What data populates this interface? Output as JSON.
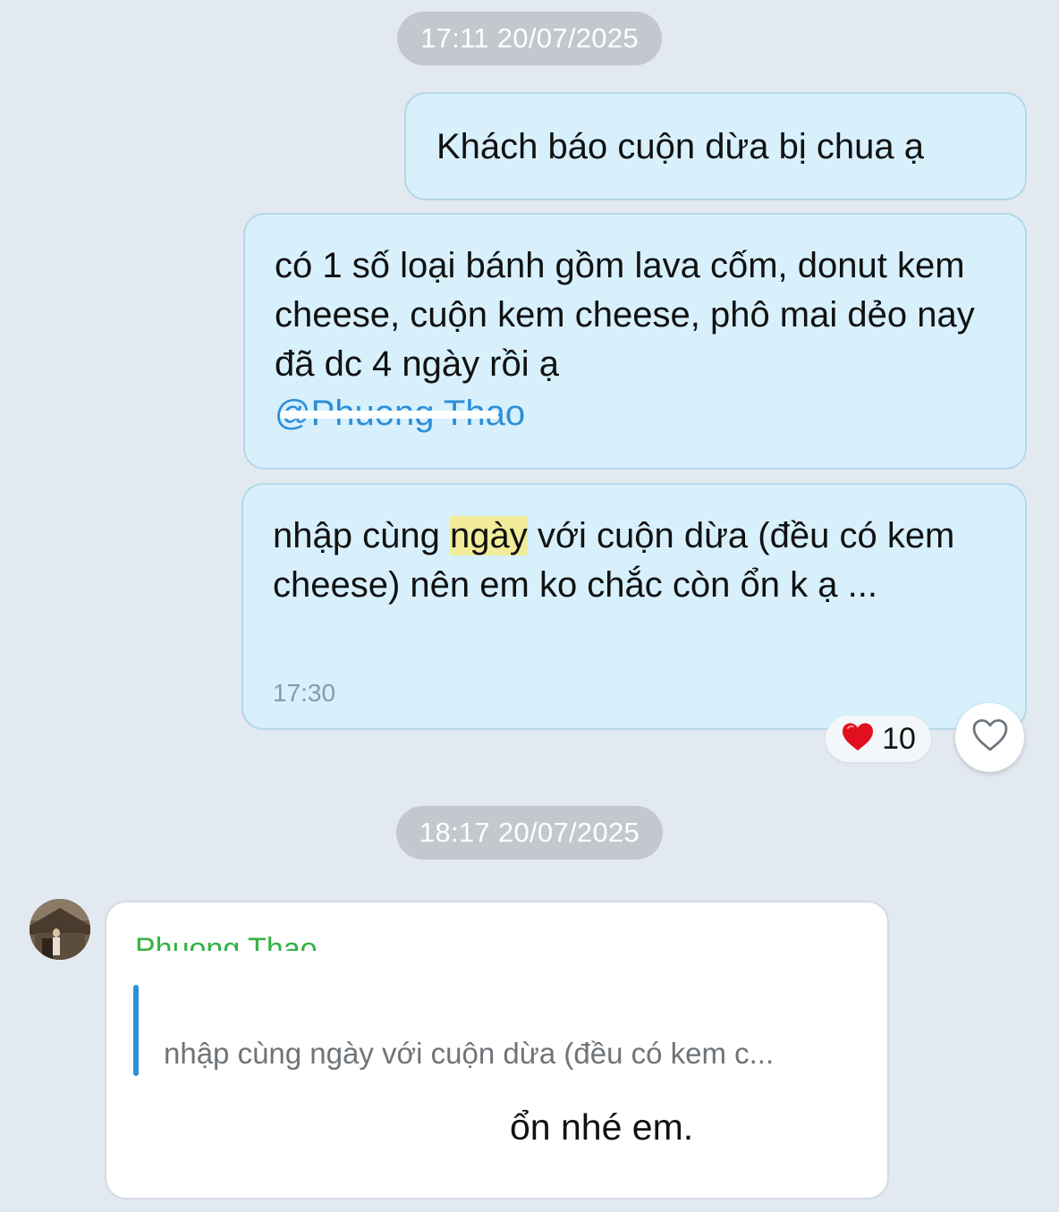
{
  "timestamps": {
    "first": "17:11 20/07/2025",
    "second": "18:17 20/07/2025"
  },
  "messages_out": [
    {
      "text": "Khách báo cuộn dừa bị chua ạ"
    },
    {
      "text": "có 1 số loại bánh gồm lava cốm, donut kem cheese, cuộn kem cheese, phô mai dẻo nay đã dc 4 ngày rồi ạ",
      "mention": "@Phuong Thao"
    },
    {
      "text_before": "nhập cùng ",
      "highlight": "ngày",
      "text_after": " với cuộn dừa (đều có kem cheese) nên em ko chắc còn ổn k ạ ...",
      "time": "17:30"
    }
  ],
  "reaction": {
    "emoji": "heart",
    "count": "10"
  },
  "incoming": {
    "sender": "Phuong Thao",
    "quote": "nhập cùng ngày với cuộn dừa (đều có kem c...",
    "text": "ổn nhé em."
  },
  "colors": {
    "background": "#e3e9f1",
    "bubble_out": "#d7f0fc",
    "mention": "#2d8fd7",
    "sender_name": "#35b244",
    "highlight": "#f2ec9a",
    "heart": "#e0101e"
  }
}
